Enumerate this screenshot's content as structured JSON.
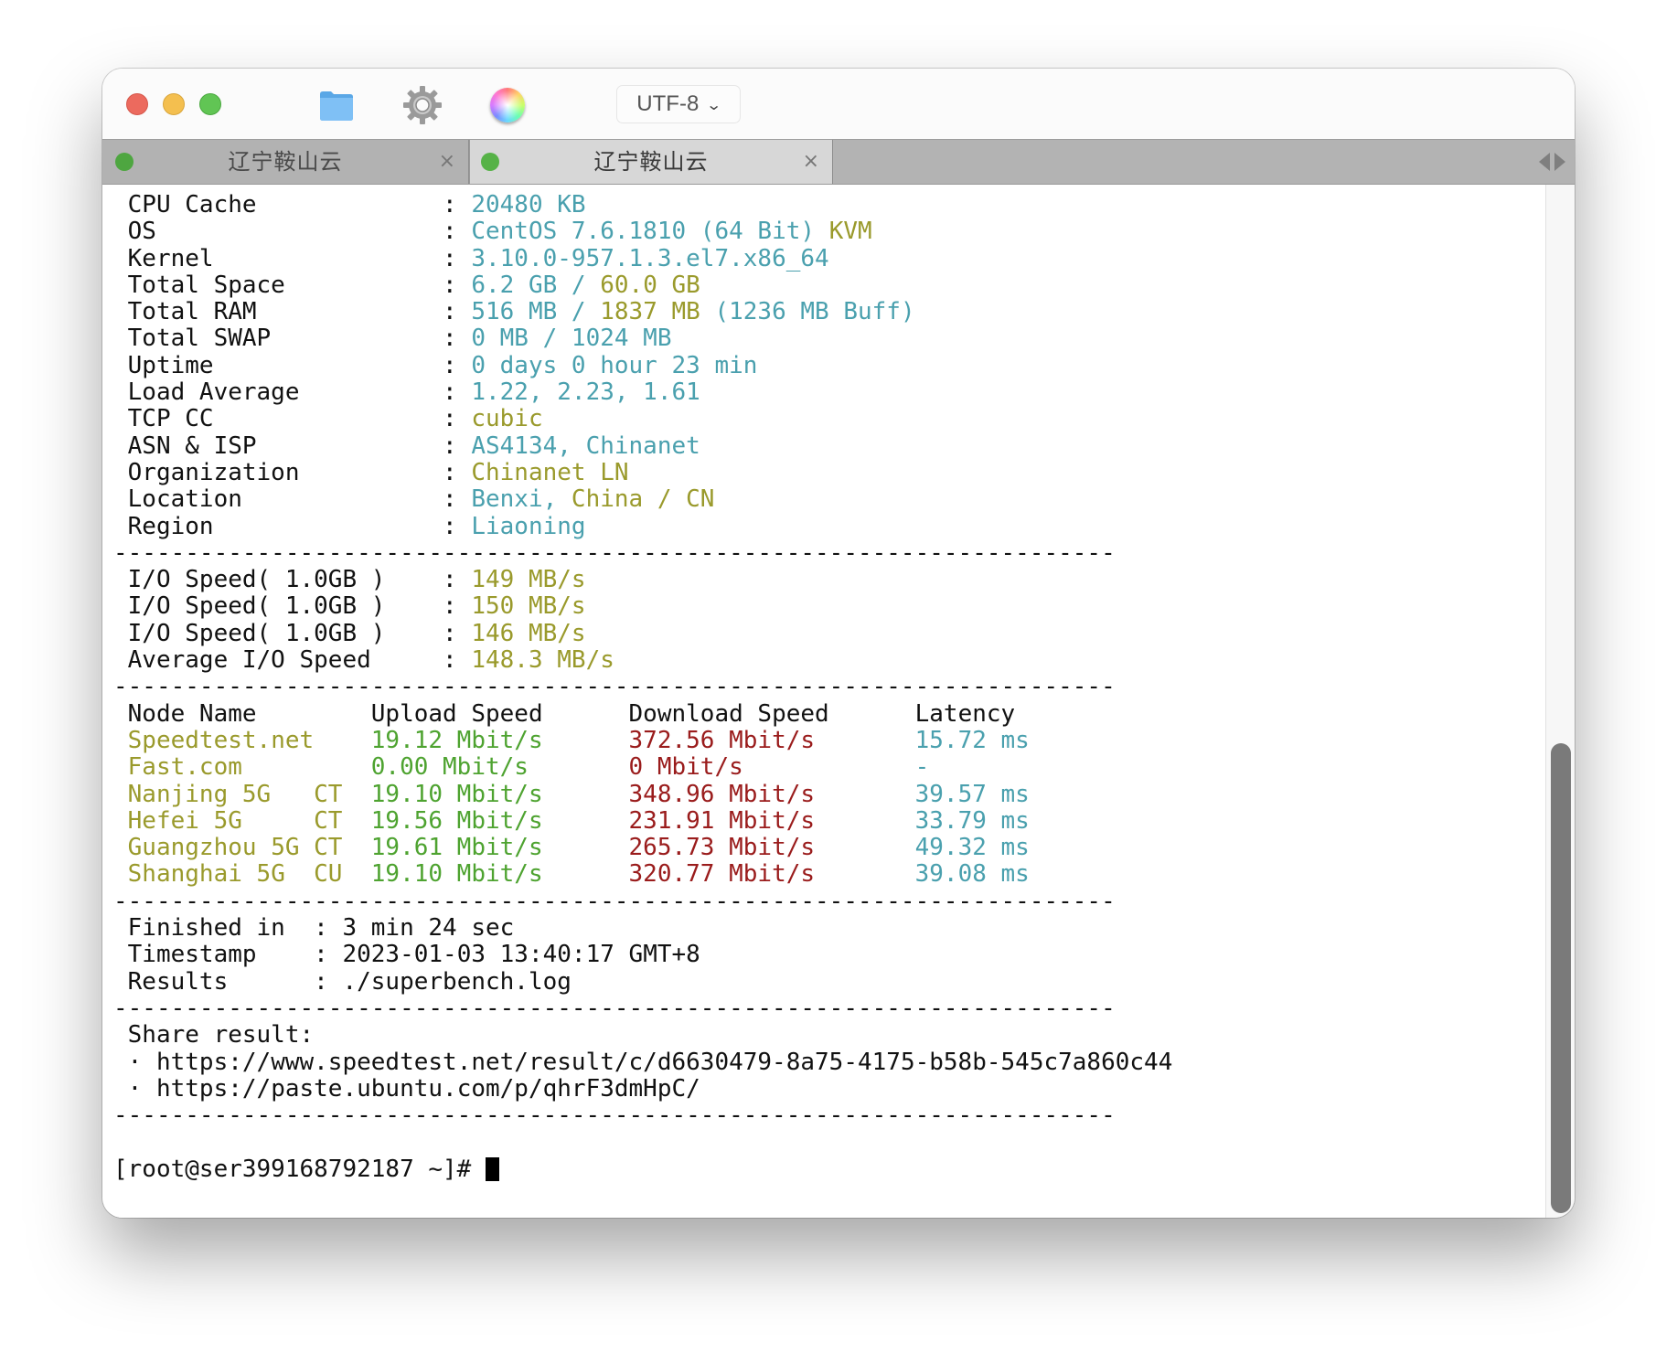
{
  "window": {
    "encoding": "UTF-8",
    "tabs": [
      {
        "title": "辽宁鞍山云",
        "active": false,
        "status_color": "#4ea640"
      },
      {
        "title": "辽宁鞍山云",
        "active": true,
        "status_color": "#56b247"
      }
    ],
    "close_glyph": "×"
  },
  "colors": {
    "teal": "#4aa0ae",
    "olive": "#9a9a2c",
    "green": "#4ea330",
    "red": "#9a1c1c"
  },
  "system_info": [
    {
      "label": "CPU Cache",
      "parts": [
        {
          "text": "20480 KB",
          "c": "t"
        }
      ]
    },
    {
      "label": "OS",
      "parts": [
        {
          "text": "CentOS 7.6.1810 (64 Bit) ",
          "c": "t"
        },
        {
          "text": "KVM",
          "c": "o"
        }
      ]
    },
    {
      "label": "Kernel",
      "parts": [
        {
          "text": "3.10.0-957.1.3.el7.x86_64",
          "c": "t"
        }
      ]
    },
    {
      "label": "Total Space",
      "parts": [
        {
          "text": "6.2 GB / ",
          "c": "t"
        },
        {
          "text": "60.0 GB",
          "c": "o"
        }
      ]
    },
    {
      "label": "Total RAM",
      "parts": [
        {
          "text": "516 MB / ",
          "c": "t"
        },
        {
          "text": "1837 MB",
          "c": "o"
        },
        {
          "text": " (1236 MB Buff)",
          "c": "t"
        }
      ]
    },
    {
      "label": "Total SWAP",
      "parts": [
        {
          "text": "0 MB / 1024 MB",
          "c": "t"
        }
      ]
    },
    {
      "label": "Uptime",
      "parts": [
        {
          "text": "0 days 0 hour 23 min",
          "c": "t"
        }
      ]
    },
    {
      "label": "Load Average",
      "parts": [
        {
          "text": "1.22, 2.23, 1.61",
          "c": "t"
        }
      ]
    },
    {
      "label": "TCP CC",
      "parts": [
        {
          "text": "cubic",
          "c": "o"
        }
      ]
    },
    {
      "label": "ASN & ISP",
      "parts": [
        {
          "text": "AS4134, Chinanet",
          "c": "t"
        }
      ]
    },
    {
      "label": "Organization",
      "parts": [
        {
          "text": "Chinanet LN",
          "c": "o"
        }
      ]
    },
    {
      "label": "Location",
      "parts": [
        {
          "text": "Benxi, ",
          "c": "t"
        },
        {
          "text": "China / CN",
          "c": "o"
        }
      ]
    },
    {
      "label": "Region",
      "parts": [
        {
          "text": "Liaoning",
          "c": "t"
        }
      ]
    }
  ],
  "separator": "----------------------------------------------------------------------",
  "io": [
    {
      "label": "I/O Speed( 1.0GB )",
      "value": "149 MB/s"
    },
    {
      "label": "I/O Speed( 1.0GB )",
      "value": "150 MB/s"
    },
    {
      "label": "I/O Speed( 1.0GB )",
      "value": "146 MB/s"
    },
    {
      "label": "Average I/O Speed",
      "value": "148.3 MB/s"
    }
  ],
  "speed_table": {
    "headers": [
      "Node Name",
      "Upload Speed",
      "Download Speed",
      "Latency"
    ],
    "rows": [
      {
        "node": "Speedtest.net",
        "upload": "19.12 Mbit/s",
        "download": "372.56 Mbit/s",
        "latency": "15.72 ms"
      },
      {
        "node": "Fast.com",
        "upload": "0.00 Mbit/s",
        "download": "0 Mbit/s",
        "latency": "-"
      },
      {
        "node": "Nanjing 5G   CT",
        "upload": "19.10 Mbit/s",
        "download": "348.96 Mbit/s",
        "latency": "39.57 ms"
      },
      {
        "node": "Hefei 5G     CT",
        "upload": "19.56 Mbit/s",
        "download": "231.91 Mbit/s",
        "latency": "33.79 ms"
      },
      {
        "node": "Guangzhou 5G CT",
        "upload": "19.61 Mbit/s",
        "download": "265.73 Mbit/s",
        "latency": "49.32 ms"
      },
      {
        "node": "Shanghai 5G  CU",
        "upload": "19.10 Mbit/s",
        "download": "320.77 Mbit/s",
        "latency": "39.08 ms"
      }
    ]
  },
  "summary": [
    {
      "label": "Finished in",
      "value": "3 min 24 sec"
    },
    {
      "label": "Timestamp",
      "value": "2023-01-03 13:40:17 GMT+8"
    },
    {
      "label": "Results",
      "value": "./superbench.log"
    }
  ],
  "share": {
    "title": "Share result:",
    "links": [
      "https://www.speedtest.net/result/c/d6630479-8a75-4175-b58b-545c7a860c44",
      "https://paste.ubuntu.com/p/qhrF3dmHpC/"
    ]
  },
  "prompt": "[root@ser399168792187 ~]# ",
  "scroll": {
    "position_fraction": 1.0,
    "visible_fraction": 0.46
  }
}
